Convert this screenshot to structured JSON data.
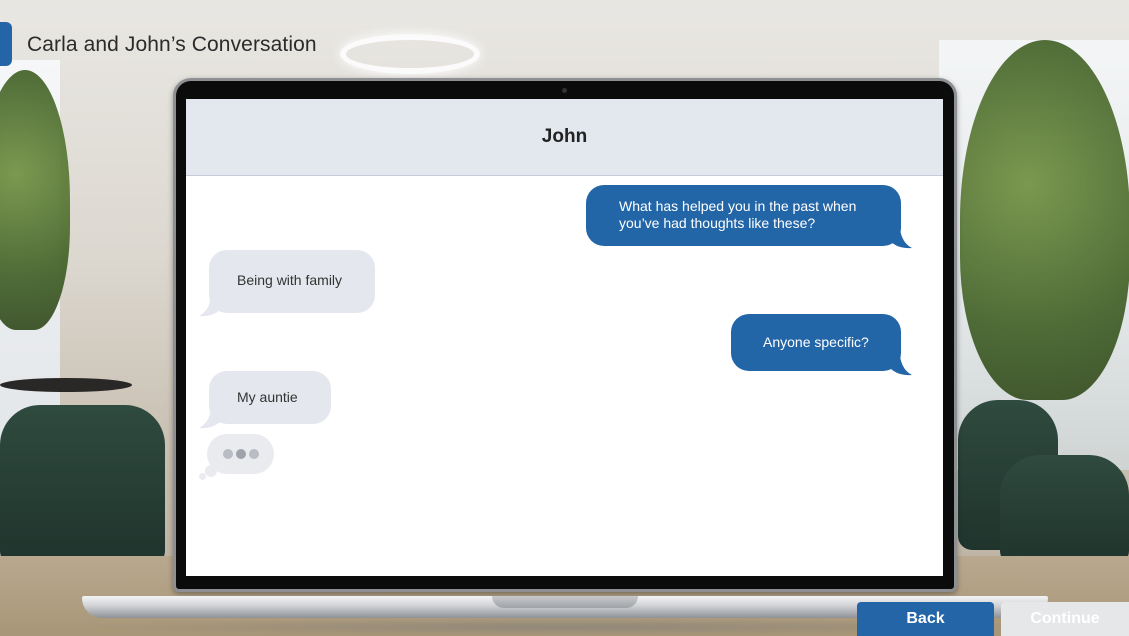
{
  "page": {
    "title": "Carla and John’s Conversation"
  },
  "chat": {
    "contact_name": "John",
    "messages": [
      {
        "from": "me",
        "text": "What has helped you in the past when you’ve had thoughts like these?"
      },
      {
        "from": "them",
        "text": "Being with family"
      },
      {
        "from": "me",
        "text": "Anyone specific?"
      },
      {
        "from": "them",
        "text": "My auntie"
      }
    ],
    "typing_indicator": true
  },
  "nav": {
    "back_label": "Back",
    "continue_label": "Continue",
    "continue_enabled": false
  },
  "colors": {
    "accent": "#2365a6",
    "outgoing_bubble": "#2366a8",
    "incoming_bubble": "#e4e7ed",
    "header_bg": "#e3e8ef"
  }
}
